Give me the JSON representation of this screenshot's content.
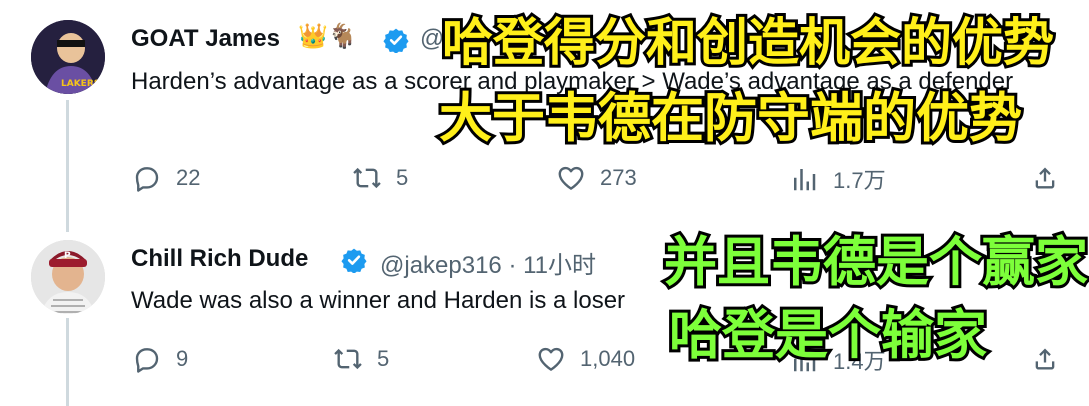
{
  "tweets": [
    {
      "name": "GOAT James",
      "emoji": "👑🐐",
      "handle": "@",
      "text": "Harden’s advantage as a scorer and playmaker > Wade’s advantage as a defender",
      "replies": "22",
      "retweets": "5",
      "likes": "273",
      "views": "1.7万"
    },
    {
      "name": "Chill Rich Dude",
      "handle": "@jakep316 · 11小时",
      "text": "Wade was also a winner and Harden is a loser",
      "replies": "9",
      "retweets": "5",
      "likes": "1,040",
      "views": "1.4万"
    }
  ],
  "overlays": {
    "top_line1": "哈登得分和创造机会的优势",
    "top_line2": "大于韦德在防守端的优势",
    "bottom_line1": "并且韦德是个赢家",
    "bottom_line2": "哈登是个输家"
  },
  "colors": {
    "verified": "#1d9bf0",
    "muted": "#536471",
    "overlay_yellow": "#ffef1a",
    "overlay_green": "#7dff3a"
  },
  "icons": [
    "reply-icon",
    "retweet-icon",
    "like-icon",
    "views-icon",
    "share-icon",
    "verified-icon"
  ]
}
